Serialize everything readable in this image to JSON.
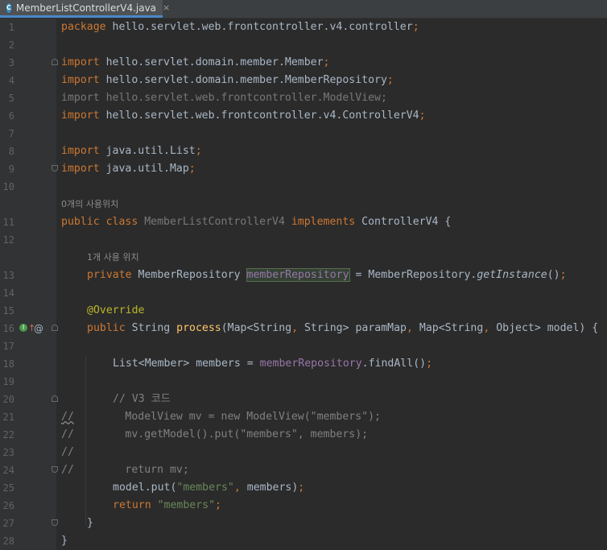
{
  "tab": {
    "title": "MemberListControllerV4.java",
    "icon_letter": "C",
    "close": "×"
  },
  "colors": {
    "keyword": "#cc7832",
    "field": "#9876aa",
    "string": "#6a8759",
    "comment": "#808080",
    "annotation": "#bbb529",
    "method": "#ffc66d"
  },
  "lines": [
    {
      "n": "1",
      "t": [
        "package",
        " hello.servlet.web.frontcontroller.v4.controller",
        ";"
      ]
    },
    {
      "n": "2"
    },
    {
      "n": "3",
      "t": [
        "import",
        " hello.servlet.domain.member.Member",
        ";"
      ]
    },
    {
      "n": "4",
      "t": [
        "import",
        " hello.servlet.domain.member.MemberRepository",
        ";"
      ]
    },
    {
      "n": "5",
      "t": [
        "import hello.servlet.web.frontcontroller.ModelView;"
      ]
    },
    {
      "n": "6",
      "t": [
        "import",
        " hello.servlet.web.frontcontroller.v4.ControllerV4",
        ";"
      ]
    },
    {
      "n": "7"
    },
    {
      "n": "8",
      "t": [
        "import",
        " java.util.List",
        ";"
      ]
    },
    {
      "n": "9",
      "t": [
        "import",
        " java.util.Map",
        ";"
      ]
    },
    {
      "n": "10"
    },
    {
      "hint": "0개의 사용위치"
    },
    {
      "n": "11",
      "t": [
        "public class ",
        "MemberListControllerV4",
        " implements ",
        "ControllerV4 {"
      ]
    },
    {
      "n": "12"
    },
    {
      "hint": "1개 사용 위치"
    },
    {
      "n": "13",
      "t": [
        "private ",
        "MemberRepository ",
        "memberRepository",
        " = MemberRepository.",
        "getInstance",
        "()",
        ";"
      ]
    },
    {
      "n": "14"
    },
    {
      "n": "15",
      "t": [
        "@Override"
      ]
    },
    {
      "n": "16",
      "t": [
        "public ",
        "String ",
        "process",
        "(Map<String",
        ", ",
        "String> paramMap",
        ", ",
        "Map<String",
        ", ",
        "Object> model) {"
      ]
    },
    {
      "n": "17"
    },
    {
      "n": "18",
      "t": [
        "List<Member> members = ",
        "memberRepository",
        ".findAll()",
        ";"
      ]
    },
    {
      "n": "19"
    },
    {
      "n": "20",
      "t": [
        "// V3 코드"
      ]
    },
    {
      "n": "21",
      "t": [
        "//",
        "        ModelView mv = new ModelView(\"members\");"
      ]
    },
    {
      "n": "22",
      "t": [
        "//",
        "        mv.getModel().put(\"members\", members);"
      ]
    },
    {
      "n": "23",
      "t": [
        "//"
      ]
    },
    {
      "n": "24",
      "t": [
        "//",
        "        return mv;"
      ]
    },
    {
      "n": "25",
      "t": [
        "model.put(",
        "\"members\"",
        ", ",
        "members)",
        ";"
      ]
    },
    {
      "n": "26",
      "t": [
        "return ",
        "\"members\"",
        ";"
      ]
    },
    {
      "n": "27",
      "t": [
        "}"
      ]
    },
    {
      "n": "28",
      "t": [
        "}"
      ]
    }
  ]
}
